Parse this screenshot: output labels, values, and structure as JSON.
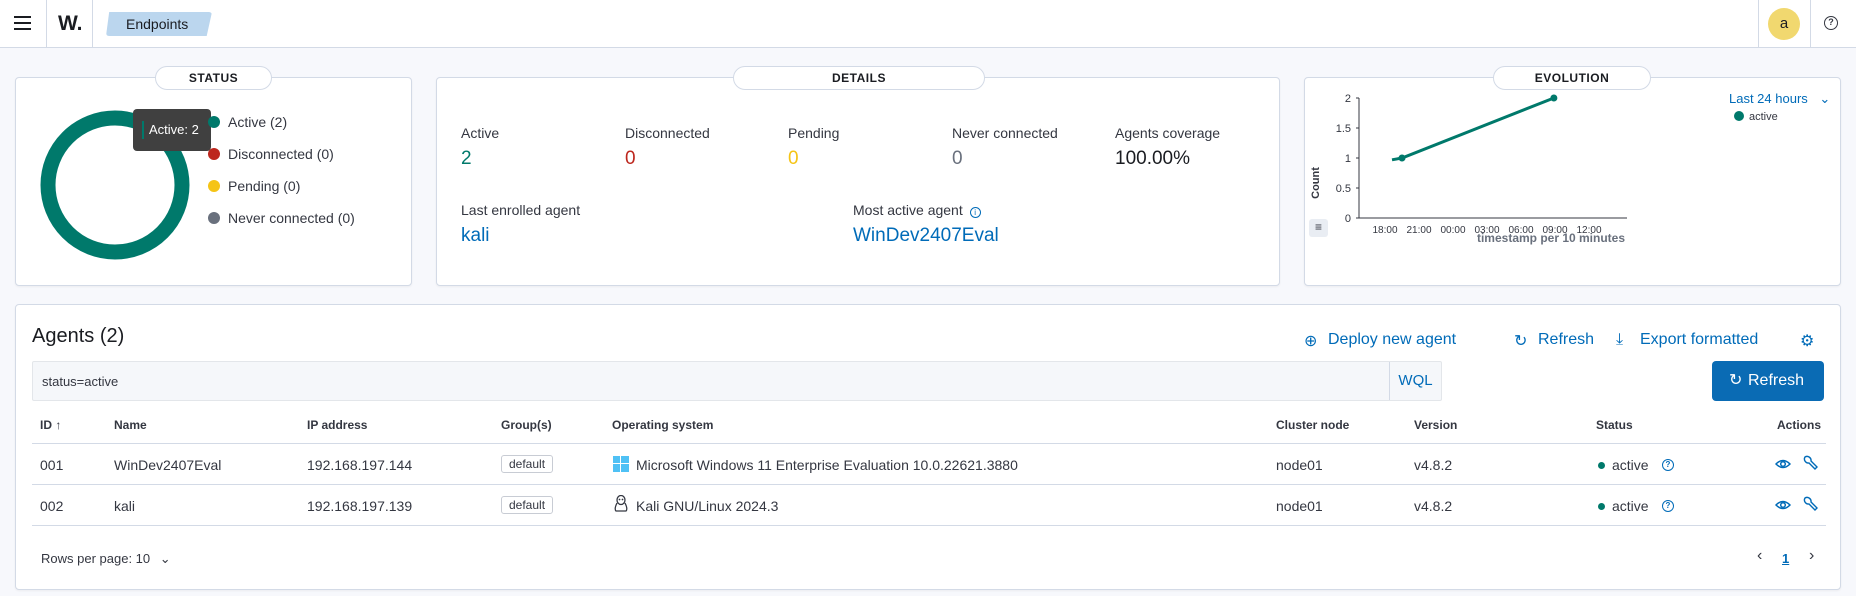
{
  "topbar": {
    "logo": "W.",
    "breadcrumb": "Endpoints",
    "avatar_initial": "a"
  },
  "status_panel": {
    "title": "STATUS",
    "tooltip": "Active: 2",
    "legend": [
      {
        "label": "Active (2)",
        "color": "#00796b"
      },
      {
        "label": "Disconnected (0)",
        "color": "#bd271e"
      },
      {
        "label": "Pending (0)",
        "color": "#f5c416"
      },
      {
        "label": "Never connected (0)",
        "color": "#69707d"
      }
    ]
  },
  "details_panel": {
    "title": "DETAILS",
    "stats": [
      {
        "label": "Active",
        "value": "2",
        "color": "#00796b"
      },
      {
        "label": "Disconnected",
        "value": "0",
        "color": "#bd271e"
      },
      {
        "label": "Pending",
        "value": "0",
        "color": "#f5c416"
      },
      {
        "label": "Never connected",
        "value": "0",
        "color": "#69707d"
      },
      {
        "label": "Agents coverage",
        "value": "100.00%",
        "color": "#1a1c21"
      }
    ],
    "last_enrolled_label": "Last enrolled agent",
    "last_enrolled_value": "kali",
    "most_active_label": "Most active agent",
    "most_active_value": "WinDev2407Eval"
  },
  "evolution_panel": {
    "title": "EVOLUTION",
    "range": "Last 24 hours",
    "chart_data": {
      "type": "line",
      "xlabel": "timestamp per 10 minutes",
      "ylabel": "Count",
      "x_ticks": [
        "18:00",
        "21:00",
        "00:00",
        "03:00",
        "06:00",
        "09:00",
        "12:00"
      ],
      "y_ticks": [
        "0",
        "0.5",
        "1",
        "1.5",
        "2"
      ],
      "ylim": [
        0,
        2
      ],
      "series": [
        {
          "name": "active",
          "color": "#00796b",
          "points": [
            [
              19.5,
              1
            ],
            [
              32.9,
              2
            ]
          ]
        }
      ]
    }
  },
  "agents": {
    "title": "Agents (2)",
    "actions": {
      "deploy": "Deploy new agent",
      "refresh": "Refresh",
      "export": "Export formatted"
    },
    "search_value": "status=active",
    "wql": "WQL",
    "refresh_button": "Refresh",
    "columns": [
      "ID",
      "Name",
      "IP address",
      "Group(s)",
      "Operating system",
      "Cluster node",
      "Version",
      "Status",
      "Actions"
    ],
    "rows": [
      {
        "id": "001",
        "name": "WinDev2407Eval",
        "ip": "192.168.197.144",
        "group": "default",
        "os": "Microsoft Windows 11 Enterprise Evaluation 10.0.22621.3880",
        "os_icon": "windows-icon",
        "node": "node01",
        "version": "v4.8.2",
        "status": "active"
      },
      {
        "id": "002",
        "name": "kali",
        "ip": "192.168.197.139",
        "group": "default",
        "os": "Kali GNU/Linux 2024.3",
        "os_icon": "linux-icon",
        "node": "node01",
        "version": "v4.8.2",
        "status": "active"
      }
    ],
    "rows_per_page": "Rows per page: 10",
    "page": "1"
  }
}
